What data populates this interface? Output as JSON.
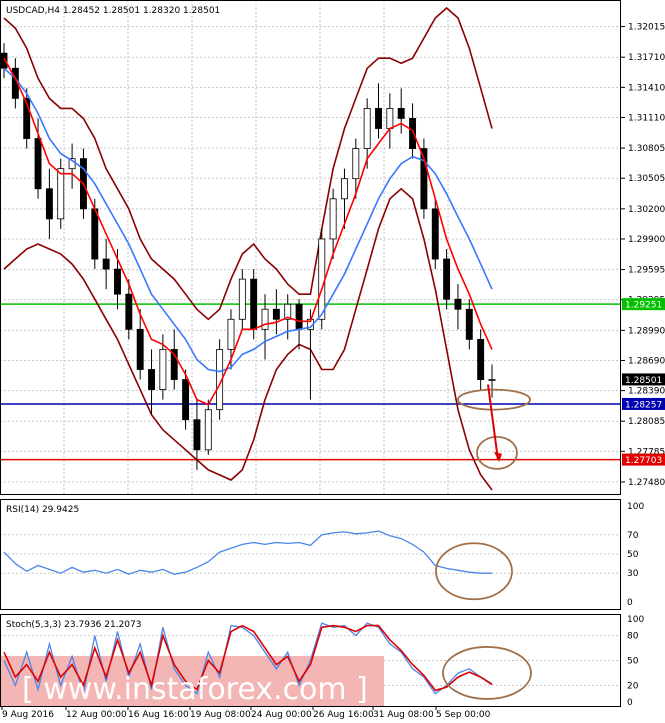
{
  "chart_data": [
    {
      "type": "candlestick",
      "symbol_header": "USDCAD,H4  1.28452 1.28501 1.28320 1.28501",
      "ylim": [
        1.274,
        1.322
      ],
      "y_ticks": [
        "1.32015",
        "1.31710",
        "1.31410",
        "1.31110",
        "1.30805",
        "1.30505",
        "1.30200",
        "1.29900",
        "1.29595",
        "1.29295",
        "1.28990",
        "1.28690",
        "1.28390",
        "1.28085",
        "1.27785",
        "1.27480"
      ],
      "price_tags": [
        {
          "label": "1.29251",
          "value": 1.29251,
          "color": "#00c000"
        },
        {
          "label": "1.28501",
          "value": 1.28501,
          "color": "#000000"
        },
        {
          "label": "1.28257",
          "value": 1.28257,
          "color": "#0000b0"
        },
        {
          "label": "1.27703",
          "value": 1.27703,
          "color": "#e00000"
        }
      ],
      "horizontal_lines": [
        {
          "value": 1.29251,
          "color": "#00c000"
        },
        {
          "value": 1.28257,
          "color": "#0000b0"
        },
        {
          "value": 1.27703,
          "color": "#e00000"
        }
      ],
      "candles": [
        [
          1.3175,
          1.3185,
          1.315,
          1.316
        ],
        [
          1.316,
          1.317,
          1.312,
          1.313
        ],
        [
          1.313,
          1.314,
          1.308,
          1.309
        ],
        [
          1.309,
          1.311,
          1.303,
          1.304
        ],
        [
          1.304,
          1.306,
          1.299,
          1.301
        ],
        [
          1.301,
          1.307,
          1.3,
          1.306
        ],
        [
          1.306,
          1.3085,
          1.304,
          1.307
        ],
        [
          1.307,
          1.308,
          1.301,
          1.302
        ],
        [
          1.302,
          1.303,
          1.296,
          1.297
        ],
        [
          1.297,
          1.299,
          1.294,
          1.296
        ],
        [
          1.296,
          1.298,
          1.292,
          1.2935
        ],
        [
          1.2935,
          1.295,
          1.289,
          1.29
        ],
        [
          1.29,
          1.292,
          1.285,
          1.286
        ],
        [
          1.286,
          1.288,
          1.2815,
          1.284
        ],
        [
          1.284,
          1.2895,
          1.283,
          1.288
        ],
        [
          1.288,
          1.29,
          1.284,
          1.285
        ],
        [
          1.285,
          1.286,
          1.28,
          1.281
        ],
        [
          1.281,
          1.283,
          1.276,
          1.278
        ],
        [
          1.278,
          1.283,
          1.2775,
          1.282
        ],
        [
          1.282,
          1.289,
          1.281,
          1.288
        ],
        [
          1.288,
          1.292,
          1.286,
          1.291
        ],
        [
          1.291,
          1.296,
          1.29,
          1.295
        ],
        [
          1.295,
          1.296,
          1.289,
          1.29
        ],
        [
          1.29,
          1.2935,
          1.287,
          1.292
        ],
        [
          1.292,
          1.294,
          1.2895,
          1.291
        ],
        [
          1.291,
          1.2935,
          1.289,
          1.2925
        ],
        [
          1.2925,
          1.293,
          1.288,
          1.29
        ],
        [
          1.29,
          1.292,
          1.283,
          1.291
        ],
        [
          1.291,
          1.3,
          1.29,
          1.299
        ],
        [
          1.299,
          1.304,
          1.297,
          1.303
        ],
        [
          1.303,
          1.306,
          1.3,
          1.305
        ],
        [
          1.305,
          1.309,
          1.303,
          1.308
        ],
        [
          1.308,
          1.313,
          1.306,
          1.312
        ],
        [
          1.312,
          1.3145,
          1.309,
          1.31
        ],
        [
          1.31,
          1.3135,
          1.308,
          1.312
        ],
        [
          1.312,
          1.314,
          1.3095,
          1.311
        ],
        [
          1.311,
          1.3125,
          1.307,
          1.308
        ],
        [
          1.308,
          1.309,
          1.301,
          1.302
        ],
        [
          1.302,
          1.303,
          1.296,
          1.297
        ],
        [
          1.297,
          1.298,
          1.292,
          1.293
        ],
        [
          1.293,
          1.2945,
          1.29,
          1.292
        ],
        [
          1.292,
          1.293,
          1.288,
          1.289
        ],
        [
          1.289,
          1.29,
          1.284,
          1.285
        ],
        [
          1.285,
          1.2865,
          1.2832,
          1.285
        ]
      ],
      "ema_fast": [
        1.317,
        1.315,
        1.3125,
        1.3095,
        1.3065,
        1.3055,
        1.3055,
        1.3045,
        1.302,
        1.2995,
        1.297,
        1.2945,
        1.2915,
        1.289,
        1.2885,
        1.2875,
        1.2855,
        1.283,
        1.2825,
        1.2845,
        1.287,
        1.29,
        1.29,
        1.2905,
        1.2907,
        1.2912,
        1.2908,
        1.2908,
        1.294,
        1.2975,
        1.3005,
        1.3035,
        1.307,
        1.3085,
        1.31,
        1.3105,
        1.3098,
        1.307,
        1.303,
        1.299,
        1.296,
        1.2935,
        1.2905,
        1.288
      ],
      "ema_slow": [
        1.316,
        1.315,
        1.3135,
        1.3115,
        1.309,
        1.3075,
        1.3068,
        1.306,
        1.3045,
        1.3025,
        1.3005,
        1.2985,
        1.296,
        1.2935,
        1.292,
        1.2905,
        1.289,
        1.287,
        1.286,
        1.2858,
        1.2862,
        1.2875,
        1.288,
        1.2888,
        1.2893,
        1.2898,
        1.29,
        1.2902,
        1.2915,
        1.2935,
        1.2955,
        1.298,
        1.3005,
        1.303,
        1.305,
        1.3065,
        1.3072,
        1.3068,
        1.3055,
        1.3035,
        1.3012,
        1.299,
        1.2965,
        1.294
      ],
      "bb_upper": [
        1.321,
        1.32,
        1.318,
        1.315,
        1.313,
        1.312,
        1.312,
        1.311,
        1.309,
        1.306,
        1.304,
        1.302,
        1.299,
        1.297,
        1.296,
        1.295,
        1.2935,
        1.292,
        1.291,
        1.292,
        1.295,
        1.2975,
        1.2985,
        1.297,
        1.296,
        1.2945,
        1.2935,
        1.2935,
        1.3,
        1.306,
        1.31,
        1.313,
        1.316,
        1.317,
        1.317,
        1.3165,
        1.317,
        1.319,
        1.321,
        1.322,
        1.321,
        1.318,
        1.314,
        1.31
      ],
      "bb_lower": [
        1.296,
        1.297,
        1.298,
        1.2985,
        1.298,
        1.2975,
        1.2965,
        1.295,
        1.293,
        1.291,
        1.289,
        1.2865,
        1.284,
        1.2815,
        1.28,
        1.279,
        1.278,
        1.277,
        1.276,
        1.2755,
        1.275,
        1.276,
        1.279,
        1.283,
        1.286,
        1.2875,
        1.2885,
        1.288,
        1.286,
        1.286,
        1.288,
        1.292,
        1.296,
        1.3,
        1.303,
        1.304,
        1.303,
        1.299,
        1.294,
        1.288,
        1.282,
        1.278,
        1.2755,
        1.274
      ],
      "annotations": [
        {
          "type": "ellipse",
          "around_value": 1.283
        },
        {
          "type": "ellipse",
          "around_value": 1.2777
        },
        {
          "type": "arrow",
          "from_value": 1.2845,
          "to_value": 1.277
        }
      ]
    },
    {
      "type": "line",
      "header": "RSI(14) 29.9425",
      "ylim": [
        0,
        100
      ],
      "y_ticks": [
        "100",
        "70",
        "50",
        "30",
        "0"
      ],
      "levels": [
        70,
        50,
        30
      ],
      "values": [
        52,
        40,
        32,
        38,
        34,
        30,
        36,
        31,
        33,
        30,
        34,
        29,
        33,
        31,
        34,
        29,
        31,
        36,
        42,
        52,
        56,
        60,
        62,
        60,
        62,
        61,
        62,
        59,
        70,
        72,
        73,
        71,
        72,
        74,
        69,
        66,
        60,
        52,
        38,
        35,
        33,
        31,
        30,
        30
      ]
    },
    {
      "type": "line",
      "header": "Stoch(5,3,3) 23.7936 21.2073",
      "ylim": [
        0,
        100
      ],
      "y_ticks": [
        "100",
        "80",
        "50",
        "20",
        "0"
      ],
      "levels": [
        80,
        50,
        20
      ],
      "series": [
        {
          "values": [
            50,
            20,
            60,
            15,
            70,
            20,
            55,
            10,
            80,
            25,
            85,
            30,
            70,
            15,
            90,
            40,
            20,
            10,
            60,
            30,
            92,
            90,
            80,
            60,
            40,
            60,
            20,
            50,
            95,
            90,
            92,
            80,
            95,
            90,
            70,
            60,
            40,
            30,
            10,
            20,
            35,
            40,
            30,
            22
          ]
        },
        {
          "values": [
            60,
            30,
            45,
            25,
            60,
            30,
            45,
            20,
            65,
            30,
            75,
            35,
            60,
            20,
            80,
            45,
            25,
            15,
            50,
            35,
            85,
            92,
            85,
            65,
            45,
            55,
            25,
            45,
            90,
            92,
            90,
            85,
            92,
            92,
            75,
            62,
            45,
            32,
            14,
            18,
            30,
            36,
            30,
            21
          ]
        }
      ]
    }
  ],
  "x_labels": [
    "9 Aug 2016",
    "12 Aug 00:00",
    "16 Aug 16:00",
    "19 Aug 08:00",
    "24 Aug 00:00",
    "26 Aug 16:00",
    "31 Aug 08:00",
    "5 Sep 00:00"
  ],
  "watermark": "www.instaforex.com"
}
